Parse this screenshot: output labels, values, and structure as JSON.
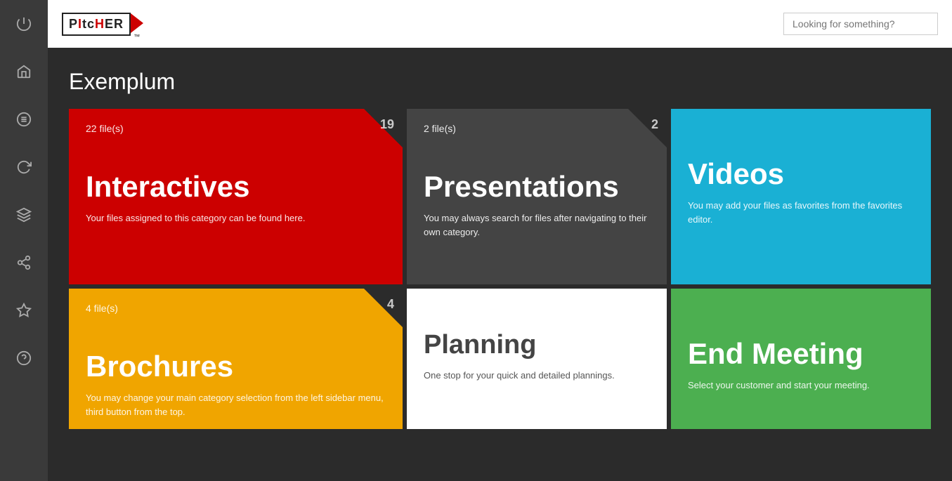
{
  "app": {
    "logo_text": "PItcHER",
    "logo_tm": "™"
  },
  "header": {
    "search_placeholder": "Looking for something?"
  },
  "page": {
    "title": "Exemplum"
  },
  "sidebar": {
    "icons": [
      {
        "name": "power-icon",
        "symbol": "⏻"
      },
      {
        "name": "home-icon",
        "symbol": "⌂"
      },
      {
        "name": "list-icon",
        "symbol": "☰"
      },
      {
        "name": "refresh-icon",
        "symbol": "↻"
      },
      {
        "name": "layers-icon",
        "symbol": "◈"
      },
      {
        "name": "share-icon",
        "symbol": "⤴"
      },
      {
        "name": "star-icon",
        "symbol": "☆"
      },
      {
        "name": "help-icon",
        "symbol": "?"
      }
    ]
  },
  "cards": [
    {
      "id": "interactives",
      "files": "22 file(s)",
      "badge": "19",
      "title": "Interactives",
      "desc": "Your files assigned to this category can be found here.",
      "color": "interactives",
      "has_triangle": true
    },
    {
      "id": "presentations",
      "files": "2 file(s)",
      "badge": "2",
      "title": "Presentations",
      "desc": "You may always search for files after navigating to their own category.",
      "color": "presentations",
      "has_triangle": true
    },
    {
      "id": "videos",
      "files": "",
      "badge": "",
      "title": "Videos",
      "desc": "You may add your files as favorites from the favorites editor.",
      "color": "videos",
      "has_triangle": false
    },
    {
      "id": "brochures",
      "files": "4 file(s)",
      "badge": "4",
      "title": "Brochures",
      "desc": "You may change your main category selection from the left sidebar menu, third button from the top.",
      "color": "brochures",
      "has_triangle": true
    },
    {
      "id": "planning",
      "files": "",
      "badge": "",
      "title": "Planning",
      "desc": "One stop for your quick and detailed plannings.",
      "color": "planning",
      "has_triangle": false
    },
    {
      "id": "end-meeting",
      "files": "",
      "badge": "",
      "title": "End Meeting",
      "desc": "Select your customer and start your meeting.",
      "color": "end-meeting",
      "has_triangle": false
    }
  ]
}
